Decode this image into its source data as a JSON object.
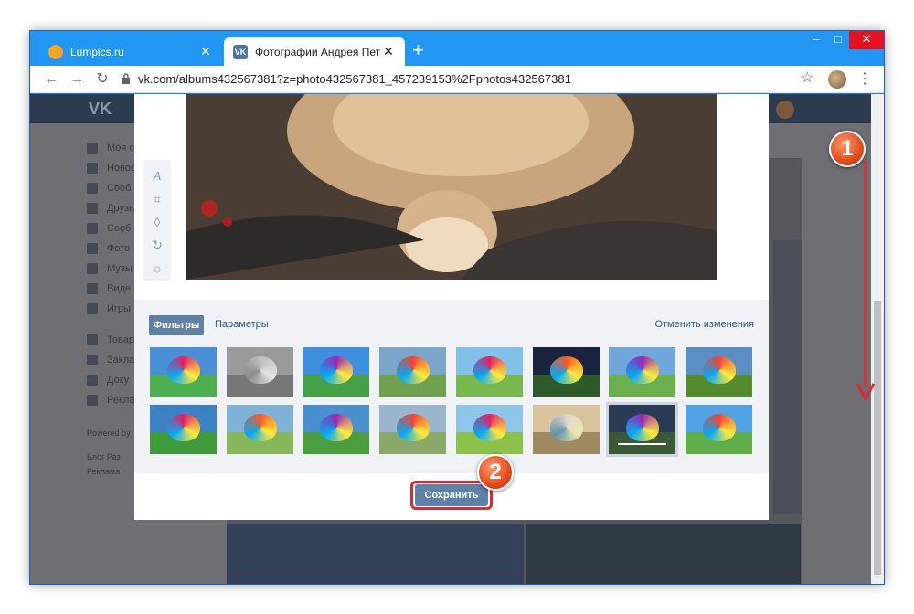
{
  "browser": {
    "tabs": [
      {
        "title": "Lumpics.ru",
        "favicon_color": "#f5a623"
      },
      {
        "title": "Фотографии Андрея Петрова –",
        "favicon_color": "#4a76a8",
        "favicon_text": "VK"
      }
    ],
    "new_tab_label": "+",
    "window_controls": {
      "minimize": "–",
      "maximize": "□",
      "close": "✕"
    },
    "url": "vk.com/albums432567381?z=photo432567381_457239153%2Fphotos432567381",
    "icons": {
      "back": "←",
      "forward": "→",
      "reload": "↻",
      "star": "☆",
      "menu": "⋮"
    }
  },
  "vk": {
    "logo": "VK",
    "menu_items": [
      "Моя с",
      "Новос",
      "Сооб",
      "Друзь",
      "Сооб",
      "Фото",
      "Музы",
      "Виде",
      "Игры",
      "Товар",
      "Закла",
      "Доку",
      "Рекла"
    ],
    "footer": [
      "Powered by",
      "Блог  Раз",
      "Реклама"
    ]
  },
  "editor": {
    "tab_filters": "Фильтры",
    "tab_params": "Параметры",
    "cancel_changes": "Отменить изменения",
    "save_label": "Сохранить",
    "filters_row1": [
      "#4a90d9|#4caf50",
      "#9a9a9a|#777777",
      "#3f8fe0|#43a047",
      "#7aa6c9|#6fa150",
      "#7fc1e8|#79b84f",
      "#1a2340|#2e5a2a",
      "#6fa7dd|#6ab04c",
      "#5b8fc4|#558b2f"
    ],
    "filters_row2": [
      "#3b82c4|#3f9a3a",
      "#7fb2d6|#86b85a",
      "#4a8fd0|#4b9e3d",
      "#9ab6cf|#8aa86a",
      "#8cc7ea|#8bc34a",
      "#d9c39a|#a08a60",
      "#2b3a55|#3b5a33",
      "#4fa3e6|#5fae4a"
    ],
    "selected_filter_index": 14
  },
  "annotations": {
    "badge1": "1",
    "badge2": "2",
    "accent_color": "#e0282e"
  }
}
